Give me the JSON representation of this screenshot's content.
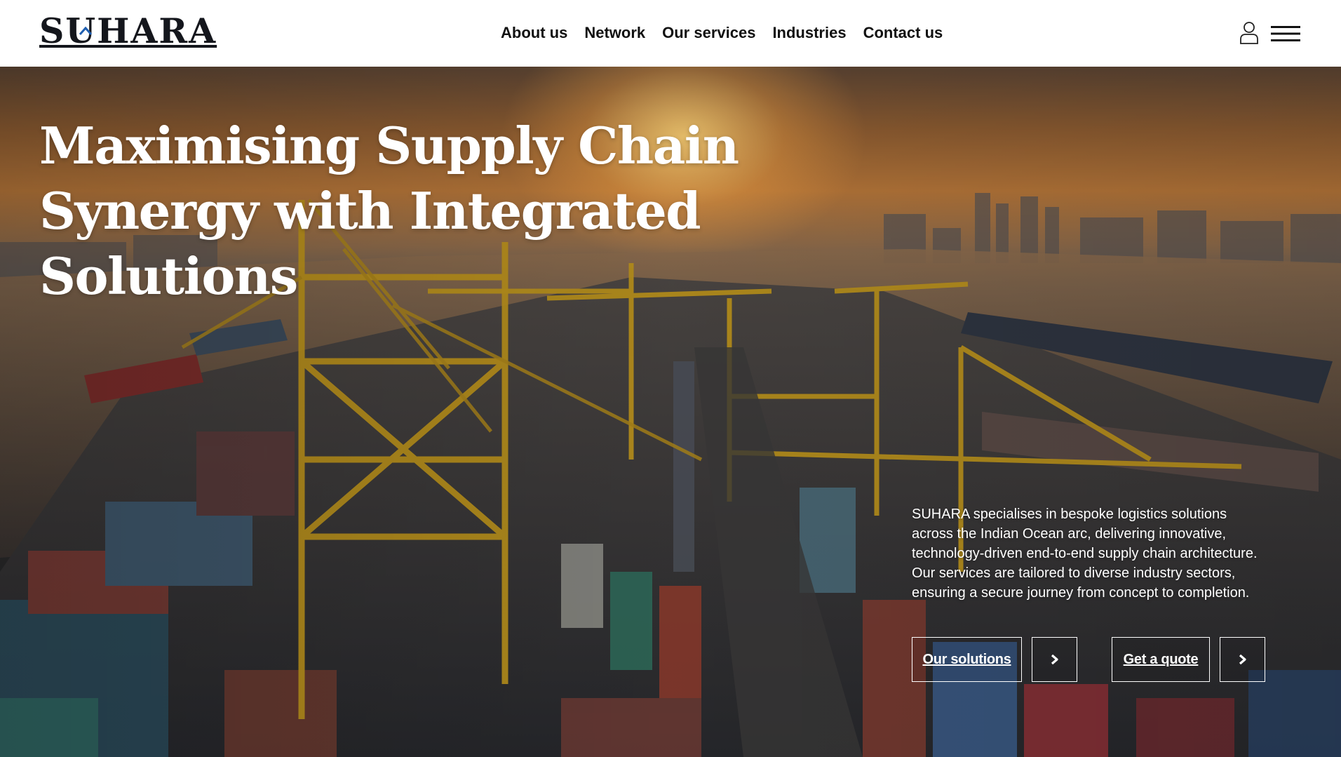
{
  "brand": {
    "logo_text": "SUHARA",
    "accent_color": "#1f5fb0"
  },
  "nav": {
    "items": [
      {
        "label": "About us"
      },
      {
        "label": "Network"
      },
      {
        "label": "Our services"
      },
      {
        "label": "Industries"
      },
      {
        "label": "Contact us"
      }
    ]
  },
  "header_icons": {
    "user": "user-icon",
    "menu": "hamburger-menu-icon"
  },
  "hero": {
    "headline_lines": [
      "Maximising Supply Chain",
      "Synergy with Integrated",
      "Solutions"
    ],
    "description_lines": [
      "SUHARA specialises in bespoke logistics solutions",
      "across the Indian Ocean arc, delivering innovative,",
      "technology-driven end-to-end supply chain architecture.",
      "Our services are tailored to diverse industry sectors,",
      "ensuring a secure journey from concept to completion."
    ],
    "buttons": {
      "solutions_label": "Our solutions",
      "quote_label": "Get a quote",
      "arrow_icon": "chevron-right-icon"
    }
  }
}
